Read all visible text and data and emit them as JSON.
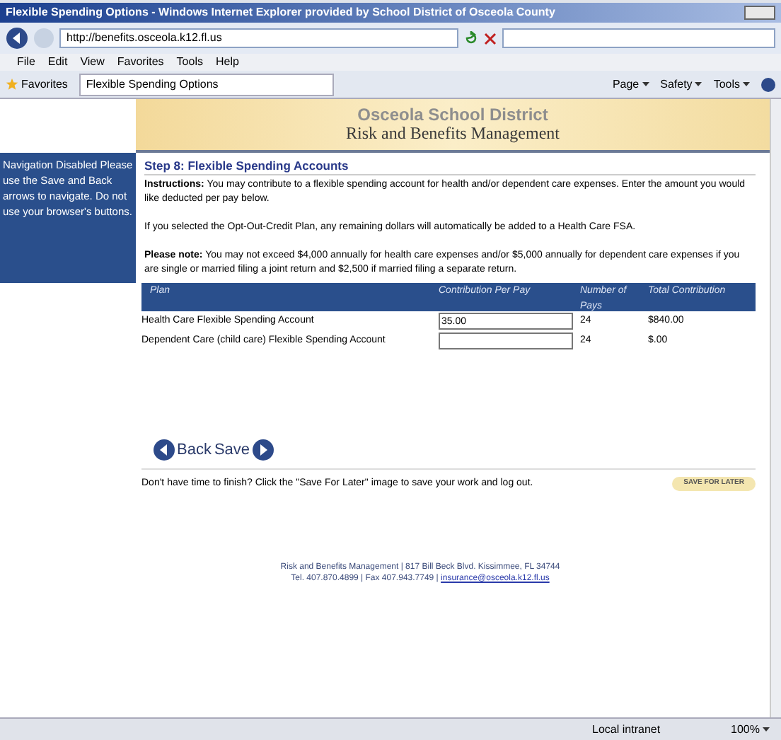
{
  "window": {
    "title": "Flexible Spending Options - Windows Internet Explorer provided by School District of Osceola County"
  },
  "address_bar": {
    "url": "http://benefits.osceola.k12.fl.us"
  },
  "menu": [
    "File",
    "Edit",
    "View",
    "Favorites",
    "Tools",
    "Help"
  ],
  "favorites_bar": {
    "favorites": "Favorites",
    "tab": "Flexible Spending Options",
    "commands": [
      "Page",
      "Safety",
      "Tools"
    ]
  },
  "banner": {
    "district": "Osceola School District",
    "department": "Risk and Benefits Management"
  },
  "sidebar": {
    "notice": "Navigation Disabled Please use the Save and Back arrows to navigate.  Do not use your browser's buttons."
  },
  "heading": "Step 8:  Flexible Spending Accounts",
  "instructions": "**Instructions:**     You may contribute to a flexible spending account for health and/or dependent care expenses. Enter the amount you would like deducted per pay below.",
  "opt_out_note": "If you selected the Opt-Out-Credit Plan, any remaining dollars will automatically be added to a Health Care FSA.",
  "please_note": "**Please note:** You may not exceed $4,000 annually for health care expenses and/or $5,000 annually for dependent care expenses if you are single or married filing a joint return and $2,500 if married filing a separate return.",
  "table": {
    "columns": [
      "Plan",
      "Contribution Per Pay",
      "Number of Pays",
      "Total Contribution"
    ],
    "rows": [
      {
        "plan": "Health Care Flexible Spending Account",
        "contribution": "35.00",
        "pays": "24",
        "total": "$840.00"
      },
      {
        "plan": "Dependent Care (child care) Flexible Spending Account",
        "contribution": "",
        "pays": "24",
        "total": "$.00"
      }
    ]
  },
  "nav_buttons": {
    "back": "Back",
    "save": "Save"
  },
  "save_later": {
    "message": "Don't have time to finish?  Click the \"Save For Later\" image to save your work and log out.",
    "button": "SAVE FOR LATER"
  },
  "footer": {
    "line1": "Risk and Benefits Management | 817 Bill Beck Blvd. Kissimmee, FL 34744",
    "line2": "Tel. 407.870.4899 | Fax 407.943.7749 | ",
    "email": "insurance@osceola.k12.fl.us"
  },
  "status_bar": {
    "zone": "Local intranet",
    "zoom": "100%"
  }
}
